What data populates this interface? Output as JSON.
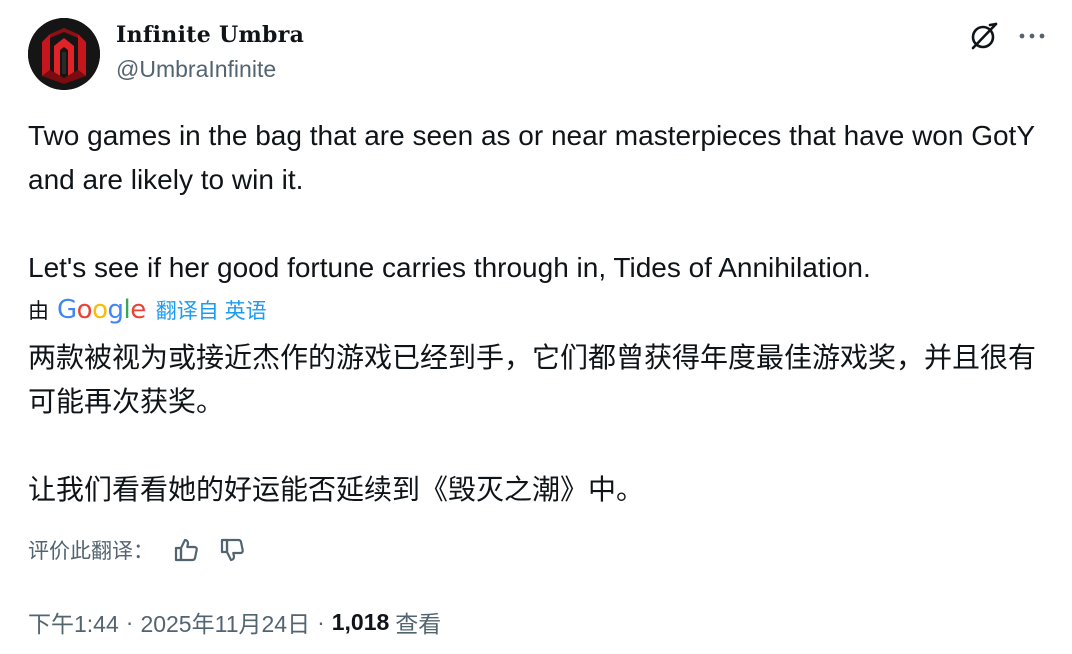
{
  "author": {
    "display_name": "Infinite Umbra",
    "handle": "@UmbraInfinite",
    "avatar_icon": "red-chevron-logo",
    "avatar_colors": {
      "background": "#151515",
      "accent": "#c4161c"
    }
  },
  "header_actions": {
    "grok_icon": "grok-icon",
    "more_icon": "more-horizontal-icon"
  },
  "tweet": {
    "paragraphs": [
      "Two games in the bag that are seen as or near masterpieces that have won GotY and are likely to win it.",
      "Let's see if her good fortune carries through in, Tides of Annihilation."
    ]
  },
  "translation": {
    "by_label": "由",
    "provider": "Google",
    "link_label": "翻译自 英语",
    "link_color": "#1d9bf0",
    "paragraphs": [
      "两款被视为或接近杰作的游戏已经到手，它们都曾获得年度最佳游戏奖，并且很有可能再次获奖。",
      "让我们看看她的好运能否延续到《毁灭之潮》中。"
    ]
  },
  "rating": {
    "label": "评价此翻译：",
    "thumbs_up_icon": "thumbs-up-icon",
    "thumbs_down_icon": "thumbs-down-icon"
  },
  "meta": {
    "time": "下午1:44",
    "separator": "·",
    "date": "2025年11月24日",
    "views_count": "1,018",
    "views_label": "查看"
  },
  "colors": {
    "text_primary": "#0f1419",
    "text_secondary": "#536471",
    "link": "#1d9bf0"
  }
}
